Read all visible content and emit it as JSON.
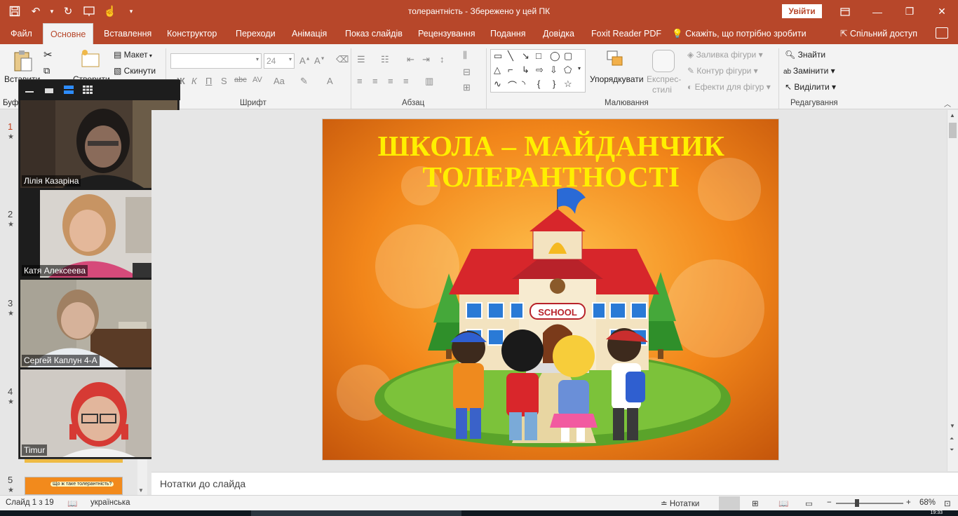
{
  "window": {
    "title": "толерантність  -  Збережено у цей ПК",
    "signin_label": "Увійти"
  },
  "tabs": [
    {
      "label": "Файл"
    },
    {
      "label": "Основне",
      "active": true
    },
    {
      "label": "Вставлення"
    },
    {
      "label": "Конструктор"
    },
    {
      "label": "Переходи"
    },
    {
      "label": "Анімація"
    },
    {
      "label": "Показ слайдів"
    },
    {
      "label": "Рецензування"
    },
    {
      "label": "Подання"
    },
    {
      "label": "Довідка"
    },
    {
      "label": "Foxit Reader PDF"
    }
  ],
  "tell_me": "Скажіть, що потрібно зробити",
  "share": "Спільний доступ",
  "ribbon": {
    "clipboard": {
      "paste": "Вставити",
      "label": "Буф"
    },
    "slides": {
      "new_slide": "Створити",
      "layout": "Макет",
      "reset": "Скинути"
    },
    "font": {
      "label": "Шрифт",
      "size_value": "24"
    },
    "paragraph": {
      "label": "Абзац"
    },
    "drawing": {
      "label": "Малювання",
      "arrange": "Упорядкувати",
      "quick_styles_1": "Експрес-",
      "quick_styles_2": "стилі",
      "shape_fill": "Заливка фігури",
      "shape_outline": "Контур фігури",
      "shape_effects": "Ефекти для фігур"
    },
    "editing": {
      "label": "Редагування",
      "find": "Знайти",
      "replace": "Замінити",
      "select": "Виділити"
    }
  },
  "thumbnails": [
    {
      "num": "1",
      "active": true
    },
    {
      "num": "2"
    },
    {
      "num": "3"
    },
    {
      "num": "4"
    },
    {
      "num": "5",
      "caption": "Що ж таке толерантність?"
    }
  ],
  "zoom": {
    "participants": [
      {
        "name": "Лілія Казаріна"
      },
      {
        "name": "Катя Алексеева"
      },
      {
        "name": "Сергей Каплун 4-А"
      },
      {
        "name": "Timur"
      }
    ]
  },
  "slide": {
    "title_line1": "ШКОЛА – МАЙДАНЧИК",
    "title_line2": "ТОЛЕРАНТНОСТІ",
    "sign_text": "SCHOOL"
  },
  "notes_placeholder": "Нотатки до слайда",
  "status": {
    "slide_info": "Слайд 1 з 19",
    "language": "українська",
    "notes_button": "Нотатки",
    "zoom_level": "68%"
  },
  "taskbar": {
    "time": "19:33"
  }
}
